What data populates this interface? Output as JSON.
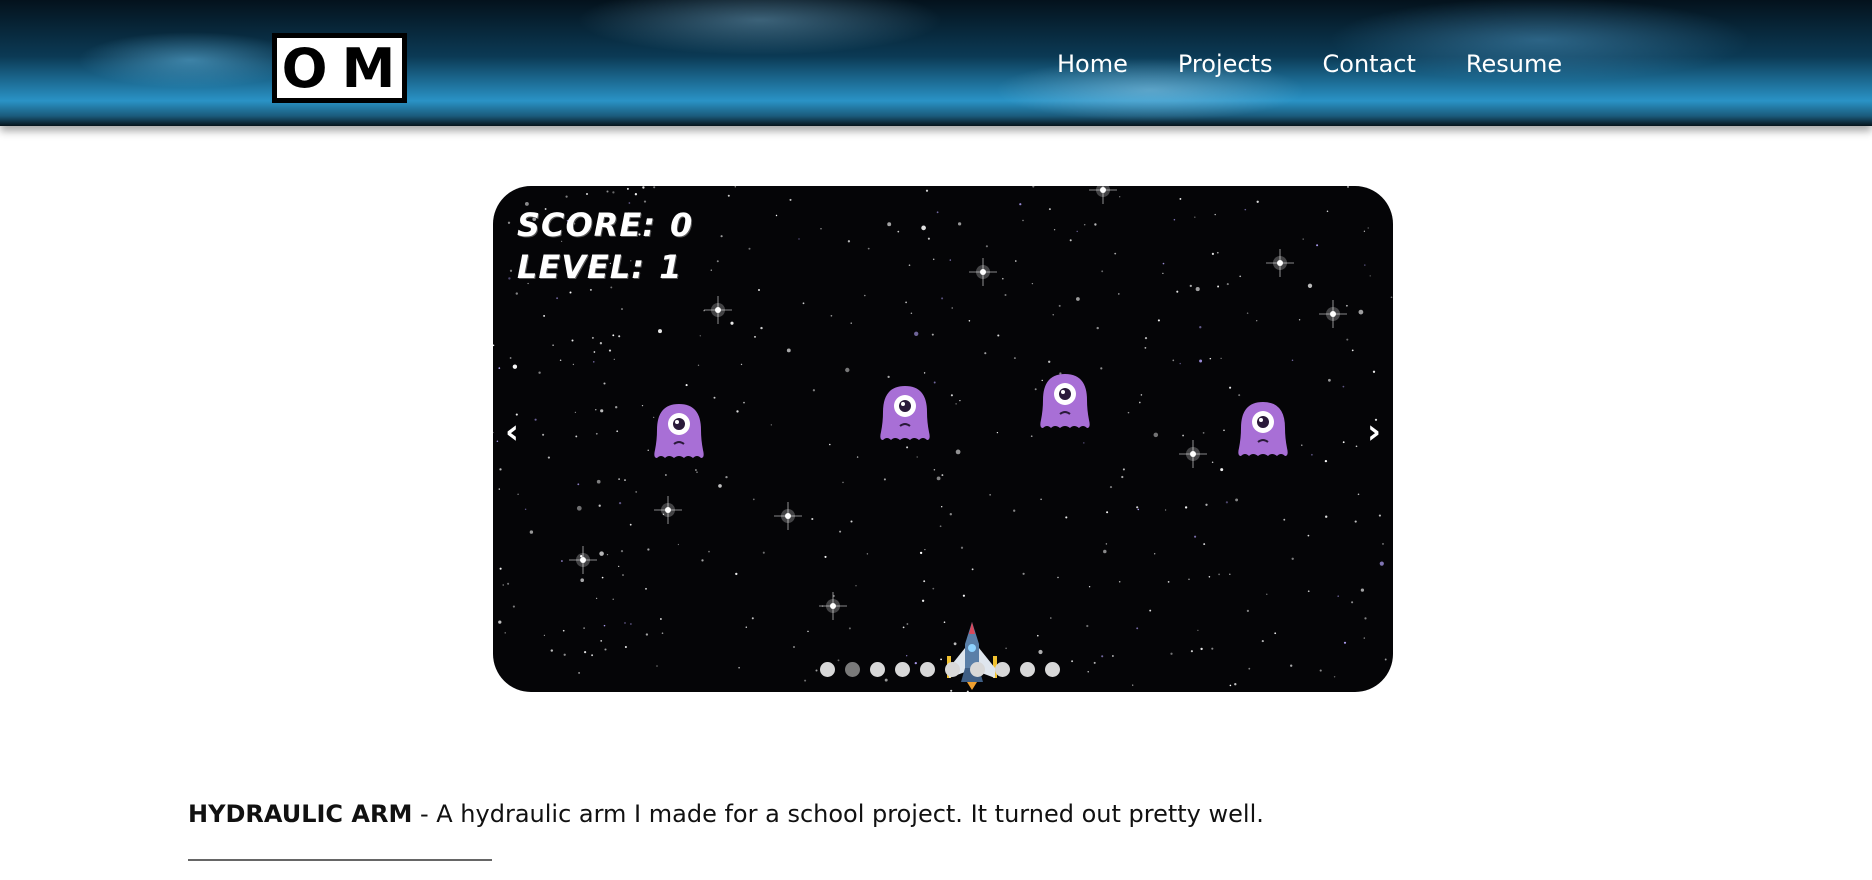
{
  "header": {
    "logo_text": "OM",
    "nav": [
      {
        "label": "Home"
      },
      {
        "label": "Projects"
      },
      {
        "label": "Contact"
      },
      {
        "label": "Resume"
      }
    ]
  },
  "carousel": {
    "score_label": "SCORE:",
    "score_value": "0",
    "level_label": "LEVEL:",
    "level_value": "1",
    "prev_label": "‹",
    "next_label": "›",
    "slide_count": 10,
    "active_slide": 2,
    "alien_icon": "purple-one-eyed-alien-icon",
    "ship_icon": "spaceship-icon",
    "alien_color": "#a86fd6"
  },
  "project": {
    "title": "HYDRAULIC ARM",
    "separator": " - ",
    "description": "A hydraulic arm I made for a school project. It turned out pretty well."
  }
}
